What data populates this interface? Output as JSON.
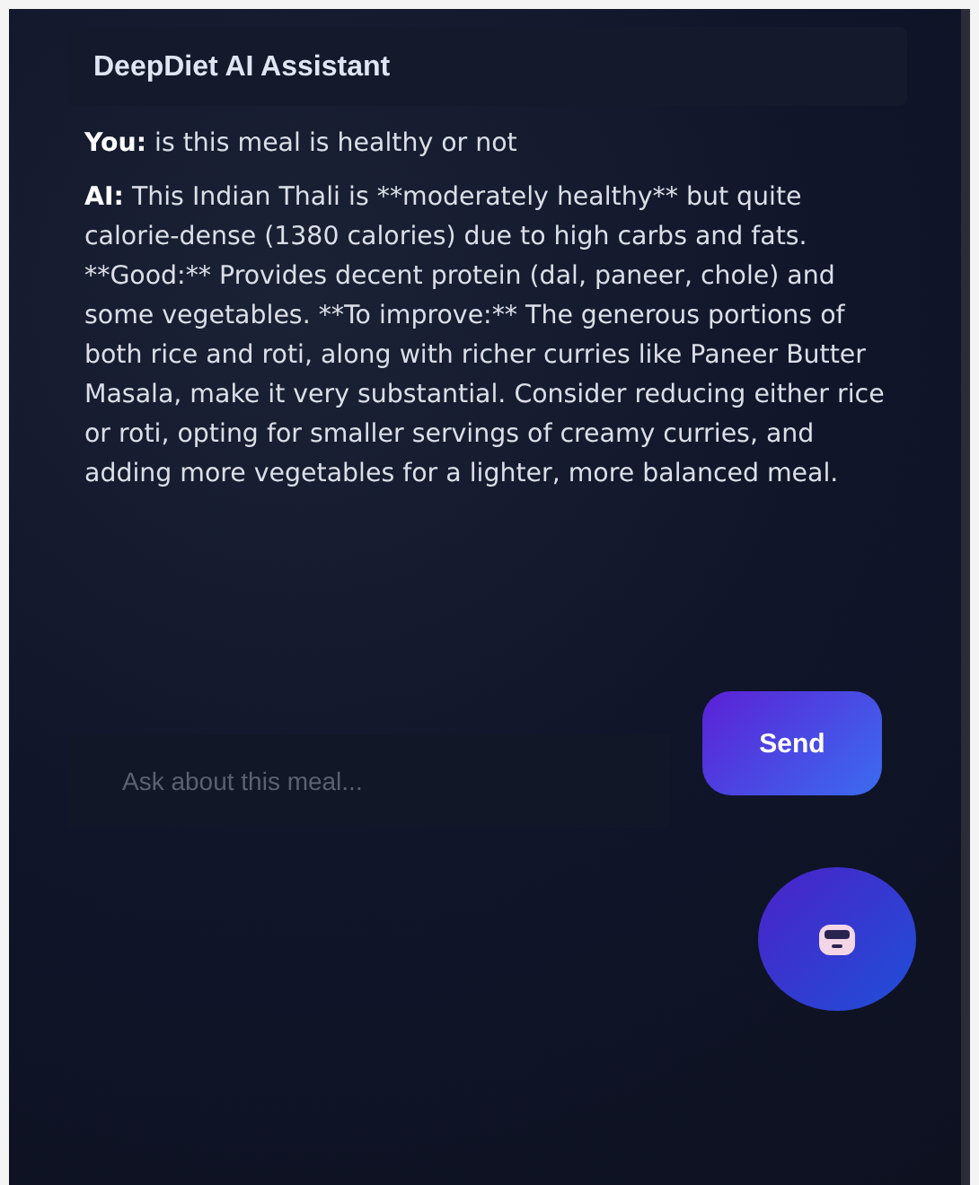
{
  "header": {
    "title": "DeepDiet AI Assistant"
  },
  "messages": [
    {
      "sender": "You:",
      "text": "is this meal is healthy or not"
    },
    {
      "sender": "AI:",
      "text": "This Indian Thali is **moderately healthy** but quite calorie-dense (1380 calories) due to high carbs and fats. **Good:** Provides decent protein (dal, paneer, chole) and some vegetables. **To improve:** The generous portions of both rice and roti, along with richer curries like Paneer Butter Masala, make it very substantial. Consider reducing either rice or roti, opting for smaller servings of creamy curries, and adding more vegetables for a lighter, more balanced meal."
    }
  ],
  "input": {
    "placeholder": "Ask about this meal..."
  },
  "send_button": "Send"
}
